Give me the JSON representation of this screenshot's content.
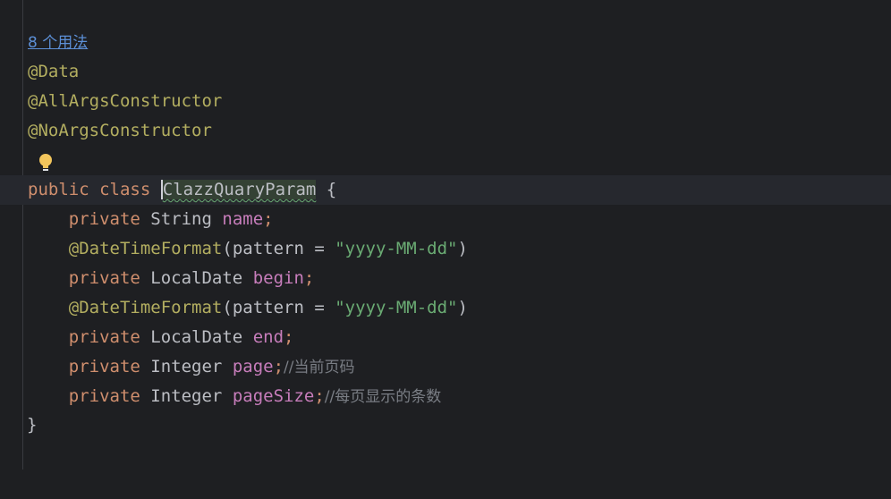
{
  "usage_hint": "8 个用法",
  "annotations": {
    "data": "@Data",
    "all_args": "@AllArgsConstructor",
    "no_args": "@NoArgsConstructor",
    "datetime_format": "@DateTimeFormat"
  },
  "class_decl": {
    "public_kw": "public",
    "class_kw": "class",
    "name": "ClazzQuaryParam",
    "open_brace": "{"
  },
  "fields": [
    {
      "modifier": "private",
      "type": "String",
      "name": "name",
      "punct": ";",
      "comment": ""
    },
    {
      "modifier": "private",
      "type": "LocalDate",
      "name": "begin",
      "punct": ";",
      "comment": ""
    },
    {
      "modifier": "private",
      "type": "LocalDate",
      "name": "end",
      "punct": ";",
      "comment": ""
    },
    {
      "modifier": "private",
      "type": "Integer",
      "name": "page",
      "punct": ";",
      "comment": "//当前页码"
    },
    {
      "modifier": "private",
      "type": "Integer",
      "name": "pageSize",
      "punct": ";",
      "comment": "//每页显示的条数"
    }
  ],
  "format_args": {
    "open": "(",
    "param": "pattern",
    "eq": " = ",
    "value": "\"yyyy-MM-dd\"",
    "close": ")"
  },
  "closing_brace": "}",
  "icons": [
    "intention-bulb-icon",
    "gutter-marker-icon"
  ],
  "colors": {
    "background": "#1e1f22",
    "annotation": "#b3ae60",
    "keyword": "#cf8e6d",
    "field": "#c77dbb",
    "string": "#6aab73",
    "comment": "#7a7e85",
    "link": "#5c8fd6"
  }
}
